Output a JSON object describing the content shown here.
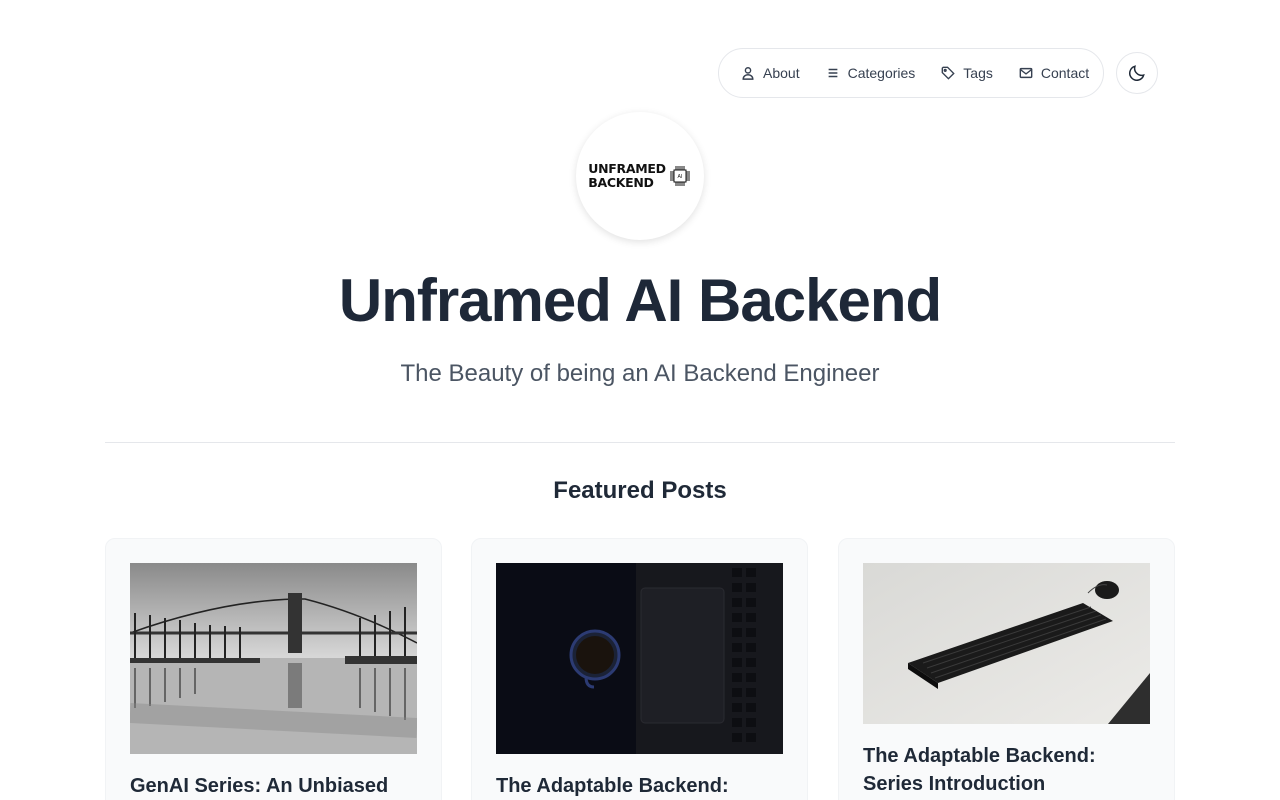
{
  "nav": {
    "items": [
      {
        "label": "About",
        "icon": "user-icon"
      },
      {
        "label": "Categories",
        "icon": "menu-icon"
      },
      {
        "label": "Tags",
        "icon": "tag-icon"
      },
      {
        "label": "Contact",
        "icon": "mail-icon"
      }
    ],
    "theme_toggle_icon": "moon-icon"
  },
  "logo": {
    "line1": "UNFRAMED",
    "line2": "BACKEND",
    "chip_text": "AI"
  },
  "site": {
    "title": "Unframed AI Backend",
    "subtitle": "The Beauty of being an AI Backend Engineer"
  },
  "featured": {
    "heading": "Featured Posts",
    "posts": [
      {
        "title": "GenAI Series: An Unbiased",
        "image": "bridge-reflection-photo"
      },
      {
        "title": "The Adaptable Backend: Node.js",
        "image": "coffee-laptop-photo"
      },
      {
        "title": "The Adaptable Backend: Series Introduction",
        "image": "keyboard-mouse-photo"
      }
    ]
  },
  "colors": {
    "title": "#1e2838",
    "subtitle": "#4b5563",
    "border": "#e5e7eb",
    "card_bg": "#f9fafb"
  }
}
